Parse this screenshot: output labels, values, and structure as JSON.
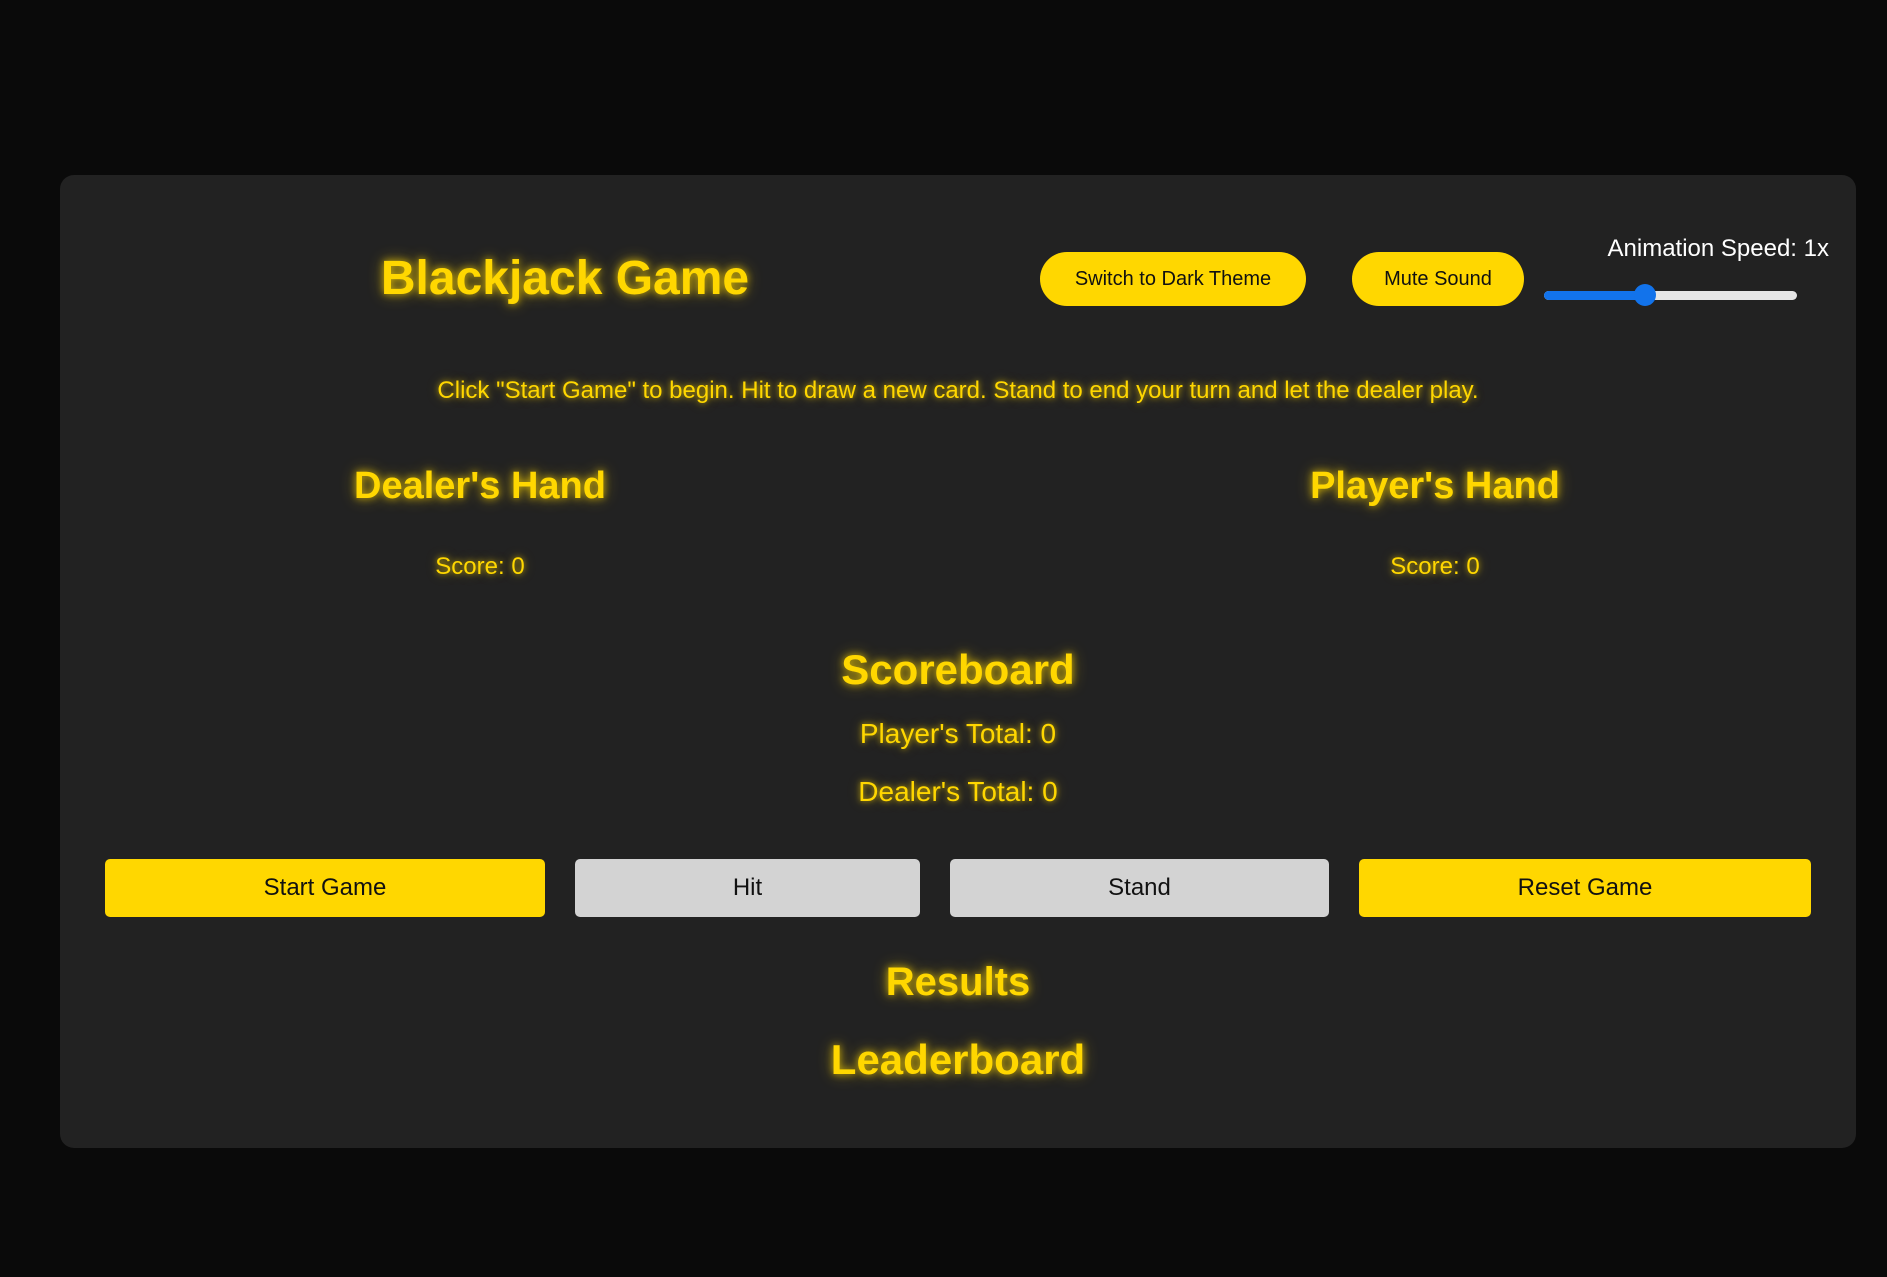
{
  "header": {
    "title": "Blackjack Game",
    "theme_button": "Switch to Dark Theme",
    "mute_button": "Mute Sound",
    "speed_label": "Animation Speed: 1x",
    "speed_level_fraction": 0.4
  },
  "instructions": "Click \"Start Game\" to begin. Hit to draw a new card. Stand to end your turn and let the dealer play.",
  "dealer": {
    "heading": "Dealer's Hand",
    "score": "Score: 0"
  },
  "player": {
    "heading": "Player's Hand",
    "score": "Score: 0"
  },
  "scoreboard": {
    "heading": "Scoreboard",
    "player_total": "Player's Total: 0",
    "dealer_total": "Dealer's Total: 0"
  },
  "controls": {
    "start": "Start Game",
    "hit": "Hit",
    "stand": "Stand",
    "reset": "Reset Game"
  },
  "results": {
    "heading": "Results"
  },
  "leaderboard": {
    "heading": "Leaderboard"
  },
  "colors": {
    "accent": "#ffd700",
    "panel": "#222222",
    "background": "#0a0a0a",
    "disabled_button": "#d3d3d3",
    "slider": "#1273eb"
  }
}
